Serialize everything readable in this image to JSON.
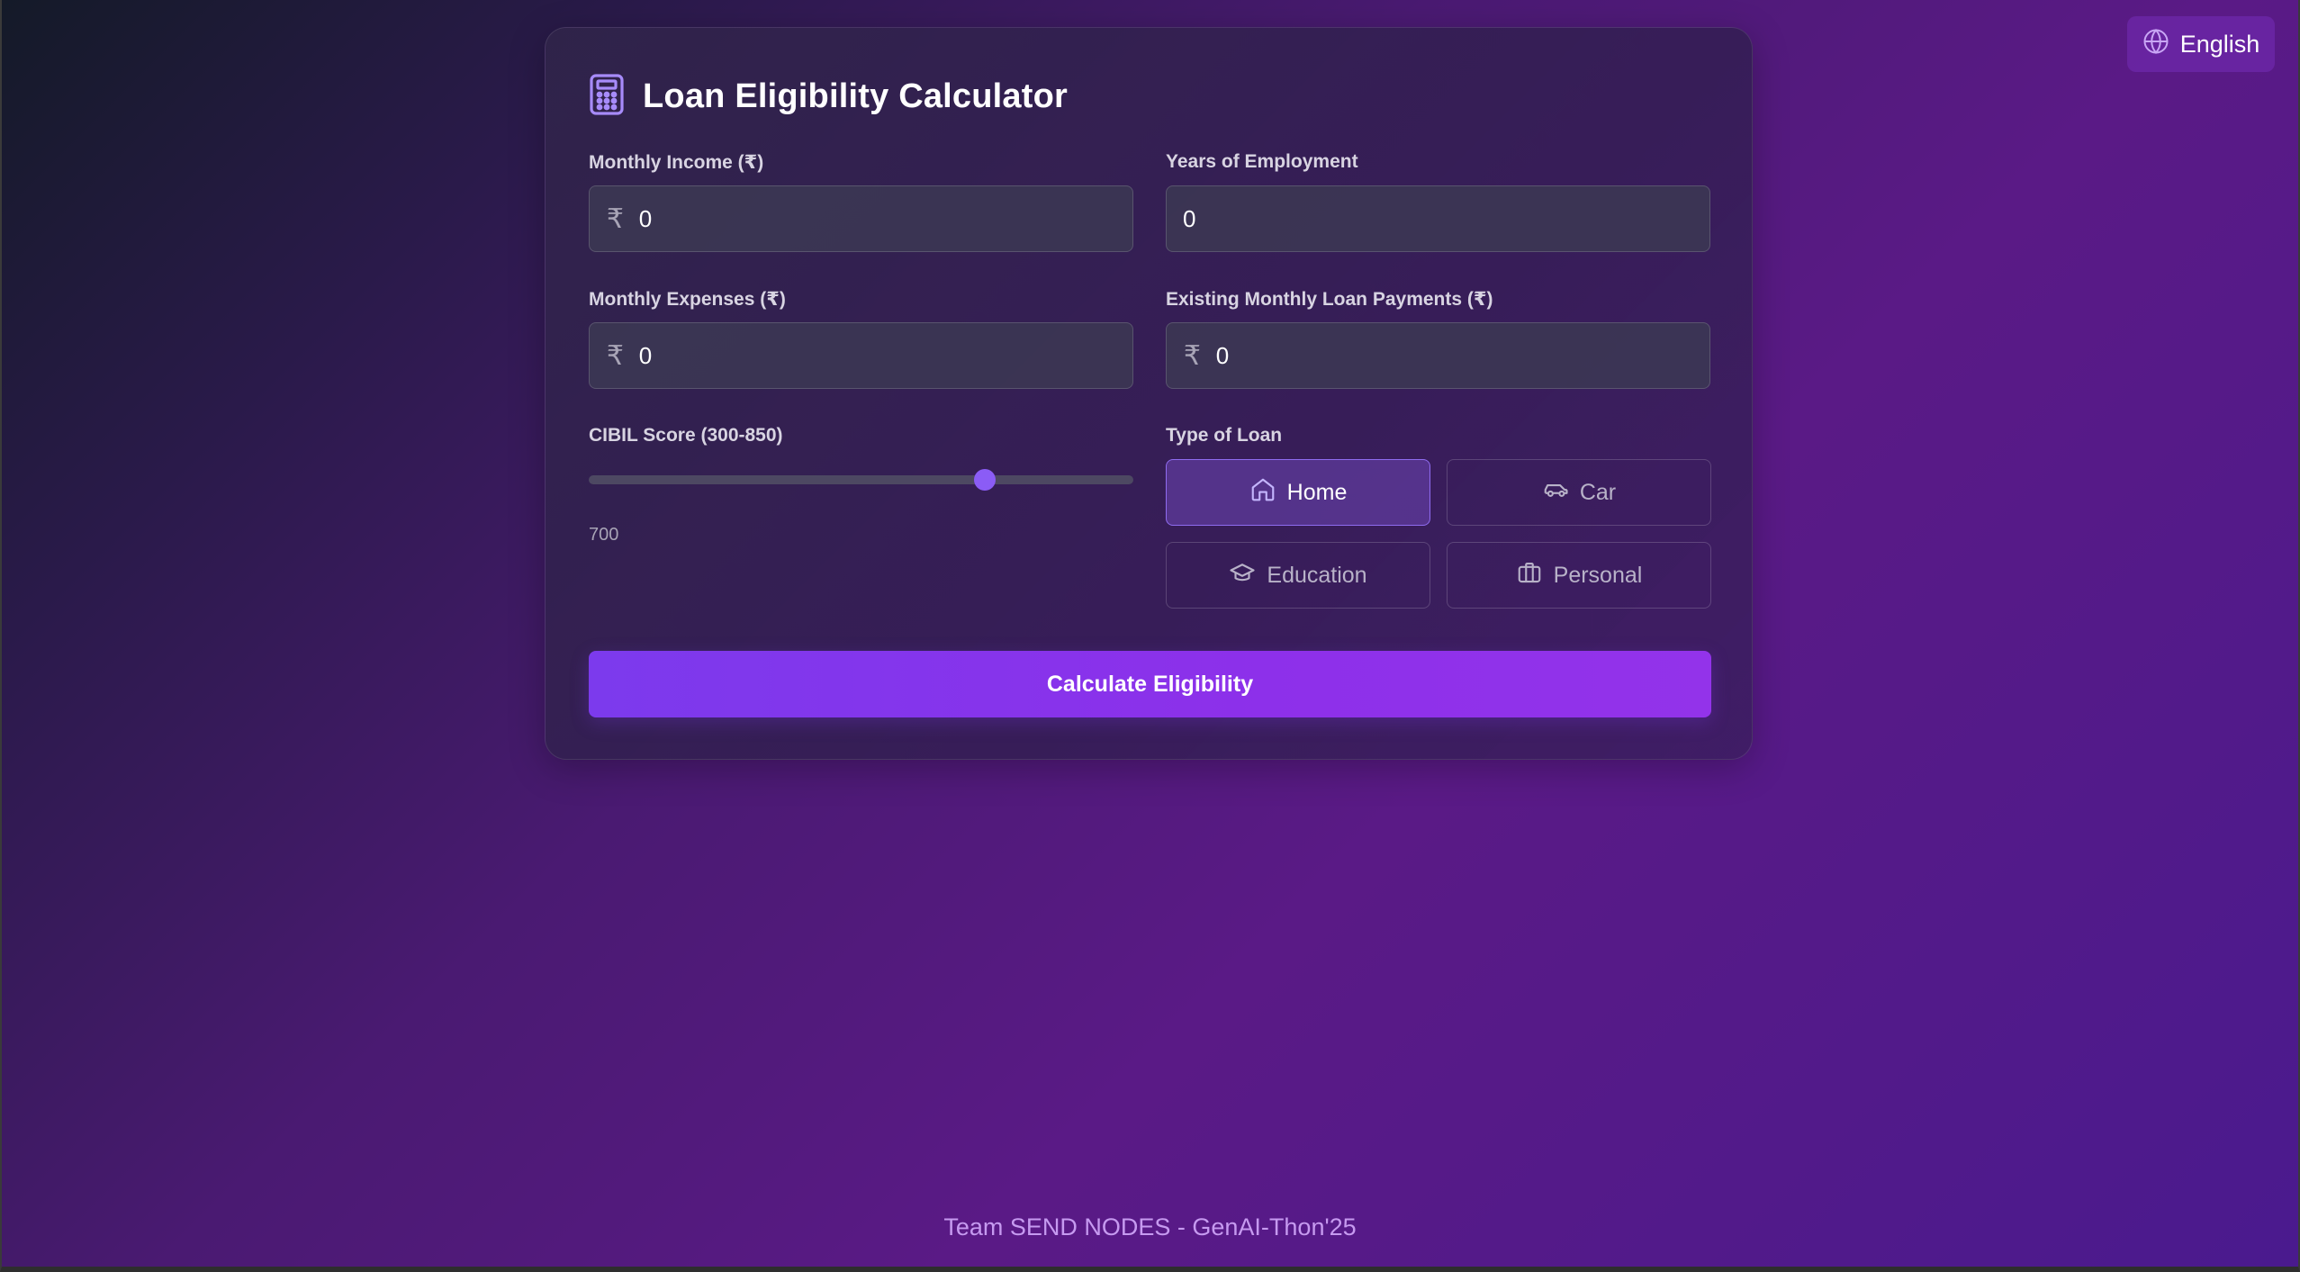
{
  "language": {
    "label": "English",
    "icon": "globe-icon"
  },
  "calculator": {
    "icon": "calculator-icon",
    "title": "Loan Eligibility Calculator",
    "monthly_income": {
      "label": "Monthly Income (₹)",
      "prefix": "₹",
      "value": "0"
    },
    "years_employment": {
      "label": "Years of Employment",
      "value": "0"
    },
    "monthly_expenses": {
      "label": "Monthly Expenses (₹)",
      "prefix": "₹",
      "value": "0"
    },
    "existing_loans": {
      "label": "Existing Monthly Loan Payments (₹)",
      "prefix": "₹",
      "value": "0"
    },
    "cibil": {
      "label": "CIBIL Score (300-850)",
      "value": "700",
      "min": 300,
      "max": 850,
      "current": 700
    },
    "loan_type": {
      "label": "Type of Loan",
      "options": [
        {
          "label": "Home",
          "icon": "home-icon",
          "selected": true
        },
        {
          "label": "Car",
          "icon": "car-icon",
          "selected": false
        },
        {
          "label": "Education",
          "icon": "graduation-cap-icon",
          "selected": false
        },
        {
          "label": "Personal",
          "icon": "briefcase-icon",
          "selected": false
        }
      ]
    },
    "submit_label": "Calculate Eligibility"
  },
  "footer": {
    "text": "Team SEND NODES - GenAI-Thon'25"
  },
  "colors": {
    "accent": "#8b5cf6",
    "button": "#7c3aed",
    "footer_text": "#c69af0"
  }
}
